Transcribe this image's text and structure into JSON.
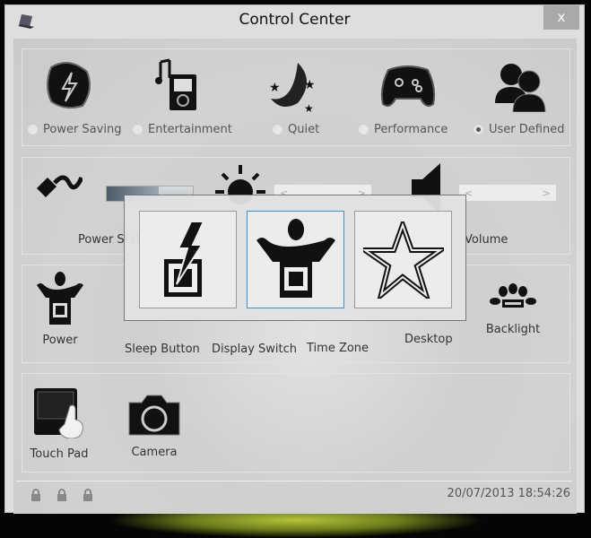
{
  "window": {
    "title": "Control Center",
    "close_label": "x"
  },
  "modes": [
    {
      "label": "Power Saving",
      "icon": "battery-bolt-icon",
      "selected": false
    },
    {
      "label": "Entertainment",
      "icon": "music-player-icon",
      "selected": false
    },
    {
      "label": "Quiet",
      "icon": "moon-stars-icon",
      "selected": false
    },
    {
      "label": "Performance",
      "icon": "gamepad-icon",
      "selected": false
    },
    {
      "label": "User Defined",
      "icon": "users-icon",
      "selected": true
    }
  ],
  "controls": {
    "power_status": "Power Status",
    "power_level_percent": 60,
    "volume": "Volume"
  },
  "features": [
    {
      "label": "Power",
      "icon": "cpu-person-icon"
    },
    {
      "label": "Sleep Button",
      "icon": "sleep-icon"
    },
    {
      "label": "Display Switch",
      "icon": "display-switch-icon"
    },
    {
      "label": "Time Zone",
      "icon": "clock-icon"
    },
    {
      "label": "Desktop",
      "icon": "desktop-icon"
    },
    {
      "label": "Backlight",
      "icon": "backlight-icon"
    }
  ],
  "devices": [
    {
      "label": "Touch Pad",
      "icon": "touchpad-icon"
    },
    {
      "label": "Camera",
      "icon": "camera-icon"
    }
  ],
  "popup": {
    "options": [
      {
        "icon": "cpu-bolt-icon"
      },
      {
        "icon": "cpu-person-icon",
        "selected": true
      },
      {
        "icon": "star-icon"
      }
    ]
  },
  "status": {
    "locks": [
      "num-lock-icon",
      "caps-lock-icon",
      "scroll-lock-icon"
    ],
    "datetime": "20/07/2013 18:54:26"
  },
  "colors": {
    "accent": "#3a8ee6",
    "glow": "#b6c43a"
  }
}
